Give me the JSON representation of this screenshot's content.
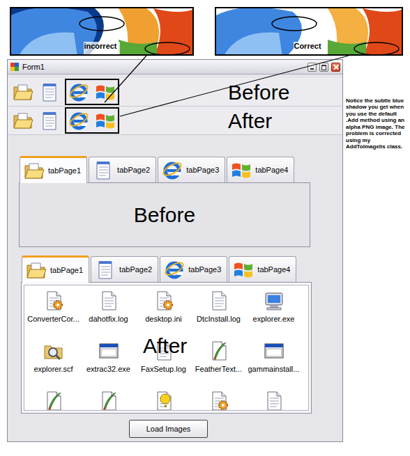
{
  "callouts": [
    {
      "label": "incorrect"
    },
    {
      "label": "Correct"
    }
  ],
  "window": {
    "title": "Form1"
  },
  "toolbars": [
    {
      "label": "Before"
    },
    {
      "label": "After"
    }
  ],
  "tab_controls": [
    {
      "tabs": [
        {
          "label": "tabPage1",
          "selected": true
        },
        {
          "label": "tabPage2",
          "selected": false
        },
        {
          "label": "tabPage3",
          "selected": false
        },
        {
          "label": "tabPage4",
          "selected": false
        }
      ],
      "overlay": "Before",
      "items": []
    },
    {
      "tabs": [
        {
          "label": "tabPage1",
          "selected": true
        },
        {
          "label": "tabPage2",
          "selected": false
        },
        {
          "label": "tabPage3",
          "selected": false
        },
        {
          "label": "tabPage4",
          "selected": false
        }
      ],
      "overlay": "After",
      "items": [
        {
          "label": "ConverterCor...",
          "kind": "config"
        },
        {
          "label": "dahotfix.log",
          "kind": "text"
        },
        {
          "label": "desktop.ini",
          "kind": "config"
        },
        {
          "label": "DtcInstall.log",
          "kind": "text"
        },
        {
          "label": "explorer.exe",
          "kind": "computer"
        },
        {
          "label": "explorer.scf",
          "kind": "search"
        },
        {
          "label": "extrac32.exe",
          "kind": "window"
        },
        {
          "label": "FaxSetup.log",
          "kind": "text"
        },
        {
          "label": "FeatherText...",
          "kind": "feather"
        },
        {
          "label": "gammainstall...",
          "kind": "window"
        },
        {
          "kind": "feather"
        },
        {
          "kind": "feather"
        },
        {
          "kind": "help"
        },
        {
          "kind": "config"
        },
        {
          "kind": "text"
        }
      ]
    }
  ],
  "buttons": [
    "Load Images"
  ],
  "note": "Notice the subtle blue shadow you get when you use the default .Add method using an alpha PNG image. The problem is corrected using my AddToImagelis class."
}
